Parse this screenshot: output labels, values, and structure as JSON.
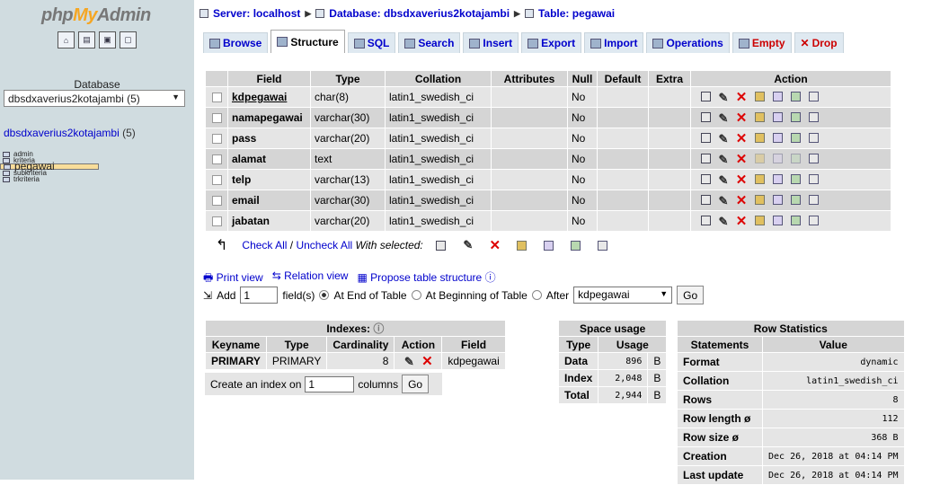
{
  "sidebar": {
    "logo": {
      "part1": "php",
      "part2": "My",
      "part3": "Admin"
    },
    "db_label": "Database",
    "db_select": "dbsdxaverius2kotajambi (5)",
    "db_name": "dbsdxaverius2kotajambi",
    "db_count": "(5)",
    "tables": [
      "admin",
      "kriteria",
      "pegawai",
      "subkriteria",
      "trkriteria"
    ]
  },
  "breadcrumb": {
    "server": "Server: localhost",
    "database": "Database: dbsdxaverius2kotajambi",
    "table": "Table: pegawai"
  },
  "tabs": [
    "Browse",
    "Structure",
    "SQL",
    "Search",
    "Insert",
    "Export",
    "Import",
    "Operations",
    "Empty",
    "Drop"
  ],
  "fields_table": {
    "headers": [
      "Field",
      "Type",
      "Collation",
      "Attributes",
      "Null",
      "Default",
      "Extra",
      "Action"
    ],
    "rows": [
      {
        "field": "kdpegawai",
        "type": "char(8)",
        "collation": "latin1_swedish_ci",
        "null": "No"
      },
      {
        "field": "namapegawai",
        "type": "varchar(30)",
        "collation": "latin1_swedish_ci",
        "null": "No"
      },
      {
        "field": "pass",
        "type": "varchar(20)",
        "collation": "latin1_swedish_ci",
        "null": "No"
      },
      {
        "field": "alamat",
        "type": "text",
        "collation": "latin1_swedish_ci",
        "null": "No"
      },
      {
        "field": "telp",
        "type": "varchar(13)",
        "collation": "latin1_swedish_ci",
        "null": "No"
      },
      {
        "field": "email",
        "type": "varchar(30)",
        "collation": "latin1_swedish_ci",
        "null": "No"
      },
      {
        "field": "jabatan",
        "type": "varchar(20)",
        "collation": "latin1_swedish_ci",
        "null": "No"
      }
    ]
  },
  "checkall": {
    "check": "Check All",
    "slash": " / ",
    "uncheck": "Uncheck All",
    "with_selected": "With selected:"
  },
  "links": {
    "print": "Print view",
    "relation": "Relation view",
    "propose": "Propose table structure"
  },
  "addfield": {
    "add": "Add",
    "count": "1",
    "fields_text": "field(s)",
    "end": "At End of Table",
    "begin": "At Beginning of Table",
    "after": "After",
    "after_value": "kdpegawai",
    "go": "Go"
  },
  "indexes": {
    "title": "Indexes:",
    "headers": [
      "Keyname",
      "Type",
      "Cardinality",
      "Action",
      "Field"
    ],
    "rows": [
      {
        "keyname": "PRIMARY",
        "type": "PRIMARY",
        "cardinality": "8",
        "field": "kdpegawai"
      }
    ],
    "create_text": "Create an index on",
    "create_count": "1",
    "columns_text": "columns",
    "go": "Go"
  },
  "space": {
    "title": "Space usage",
    "headers": [
      "Type",
      "Usage"
    ],
    "rows": [
      {
        "type": "Data",
        "value": "896",
        "unit": "B"
      },
      {
        "type": "Index",
        "value": "2,048",
        "unit": "B"
      },
      {
        "type": "Total",
        "value": "2,944",
        "unit": "B"
      }
    ]
  },
  "stats": {
    "title": "Row Statistics",
    "headers": [
      "Statements",
      "Value"
    ],
    "rows": [
      {
        "k": "Format",
        "v": "dynamic"
      },
      {
        "k": "Collation",
        "v": "latin1_swedish_ci"
      },
      {
        "k": "Rows",
        "v": "8"
      },
      {
        "k": "Row length ø",
        "v": "112"
      },
      {
        "k": "Row size ø",
        "v": "368 B"
      },
      {
        "k": "Creation",
        "v": "Dec 26, 2018 at 04:14 PM"
      },
      {
        "k": "Last update",
        "v": "Dec 26, 2018 at 04:14 PM"
      }
    ]
  }
}
